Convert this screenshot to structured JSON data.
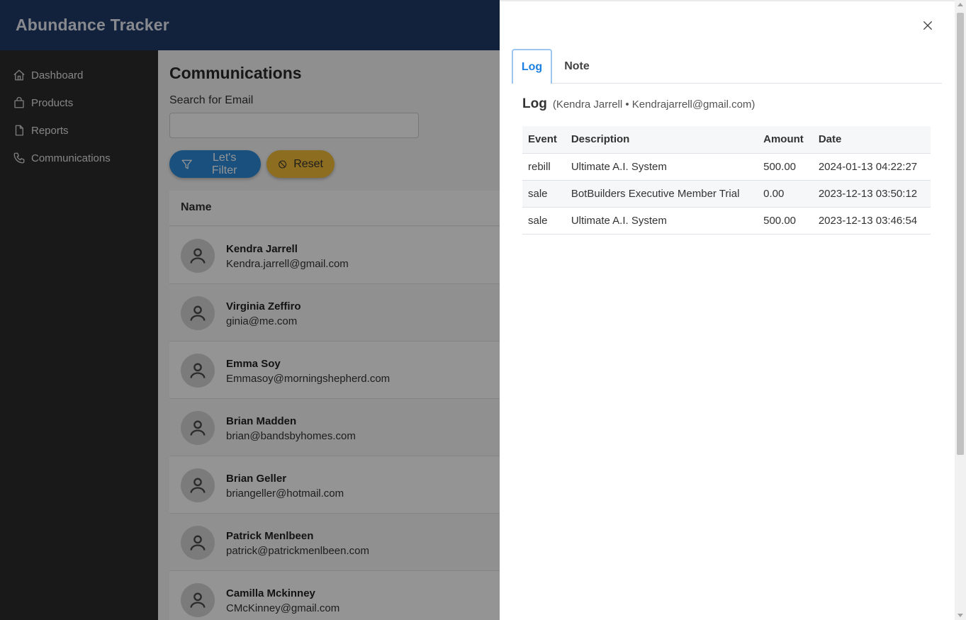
{
  "app": {
    "title": "Abundance Tracker"
  },
  "sidebar": {
    "items": [
      {
        "label": "Dashboard",
        "icon": "home-icon"
      },
      {
        "label": "Products",
        "icon": "shopping-bag-icon"
      },
      {
        "label": "Reports",
        "icon": "document-icon"
      },
      {
        "label": "Communications",
        "icon": "phone-icon"
      }
    ]
  },
  "main": {
    "title": "Communications",
    "search": {
      "label": "Search for Email",
      "value": "",
      "placeholder": ""
    },
    "filter_button": "Let's Filter",
    "reset_button": "Reset",
    "table": {
      "column": "Name",
      "rows": [
        {
          "name": "Kendra Jarrell",
          "email": "Kendra.jarrell@gmail.com"
        },
        {
          "name": "Virginia Zeffiro",
          "email": "ginia@me.com"
        },
        {
          "name": "Emma Soy",
          "email": "Emmasoy@morningshepherd.com"
        },
        {
          "name": "Brian Madden",
          "email": "brian@bandsbyhomes.com"
        },
        {
          "name": "Brian Geller",
          "email": "briangeller@hotmail.com"
        },
        {
          "name": "Patrick Menlbeen",
          "email": "patrick@patrickmenlbeen.com"
        },
        {
          "name": "Camilla Mckinney",
          "email": "CMcKinney@gmail.com"
        }
      ]
    }
  },
  "drawer": {
    "tabs": [
      {
        "label": "Log",
        "active": true
      },
      {
        "label": "Note",
        "active": false
      }
    ],
    "log_title": "Log",
    "log_meta": "(Kendra Jarrell • Kendrajarrell@gmail.com)",
    "table": {
      "headers": [
        "Event",
        "Description",
        "Amount",
        "Date"
      ],
      "rows": [
        [
          "rebill",
          "Ultimate A.I. System",
          "500.00",
          "2024-01-13 04:22:27"
        ],
        [
          "sale",
          "BotBuilders Executive Member Trial",
          "0.00",
          "2023-12-13 03:50:12"
        ],
        [
          "sale",
          "Ultimate A.I. System",
          "500.00",
          "2023-12-13 03:46:54"
        ]
      ]
    }
  },
  "colors": {
    "header": "#1f3a68",
    "sidebar": "#2b2b2b",
    "filter": "#2c8bd9",
    "reset": "#f3bd3a",
    "active_tab": "#1c7fe2"
  }
}
